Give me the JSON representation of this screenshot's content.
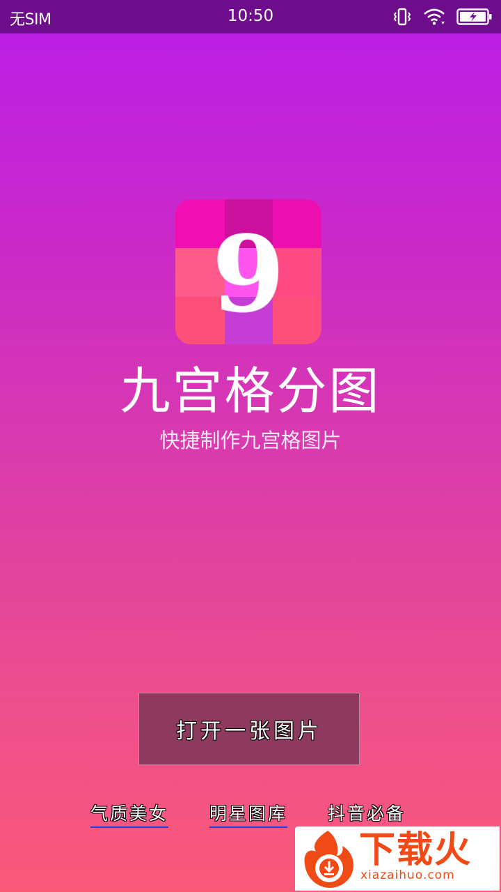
{
  "status_bar": {
    "carrier": "无SIM",
    "time": "10:50"
  },
  "app": {
    "icon_digit": "9",
    "title": "九宫格分图",
    "subtitle": "快捷制作九宫格图片"
  },
  "actions": {
    "open_image_label": "打开一张图片"
  },
  "links": [
    {
      "label": "气质美女"
    },
    {
      "label": "明星图库"
    },
    {
      "label": "抖音必备"
    }
  ],
  "watermark": {
    "brand": "下载火",
    "url": "xiazaihuo.com"
  },
  "colors": {
    "status_bar": "#6e0d8c",
    "gradient_top": "#b91de8",
    "gradient_bottom": "#fb5a7a",
    "button_bg": "#8d3a5e",
    "link_underline": "#1f3fd6",
    "watermark_orange": "#f04a17"
  },
  "icons": [
    "vibrate-icon",
    "wifi-icon",
    "battery-charging-icon",
    "nine-grid-app-icon",
    "flame-logo-icon"
  ]
}
